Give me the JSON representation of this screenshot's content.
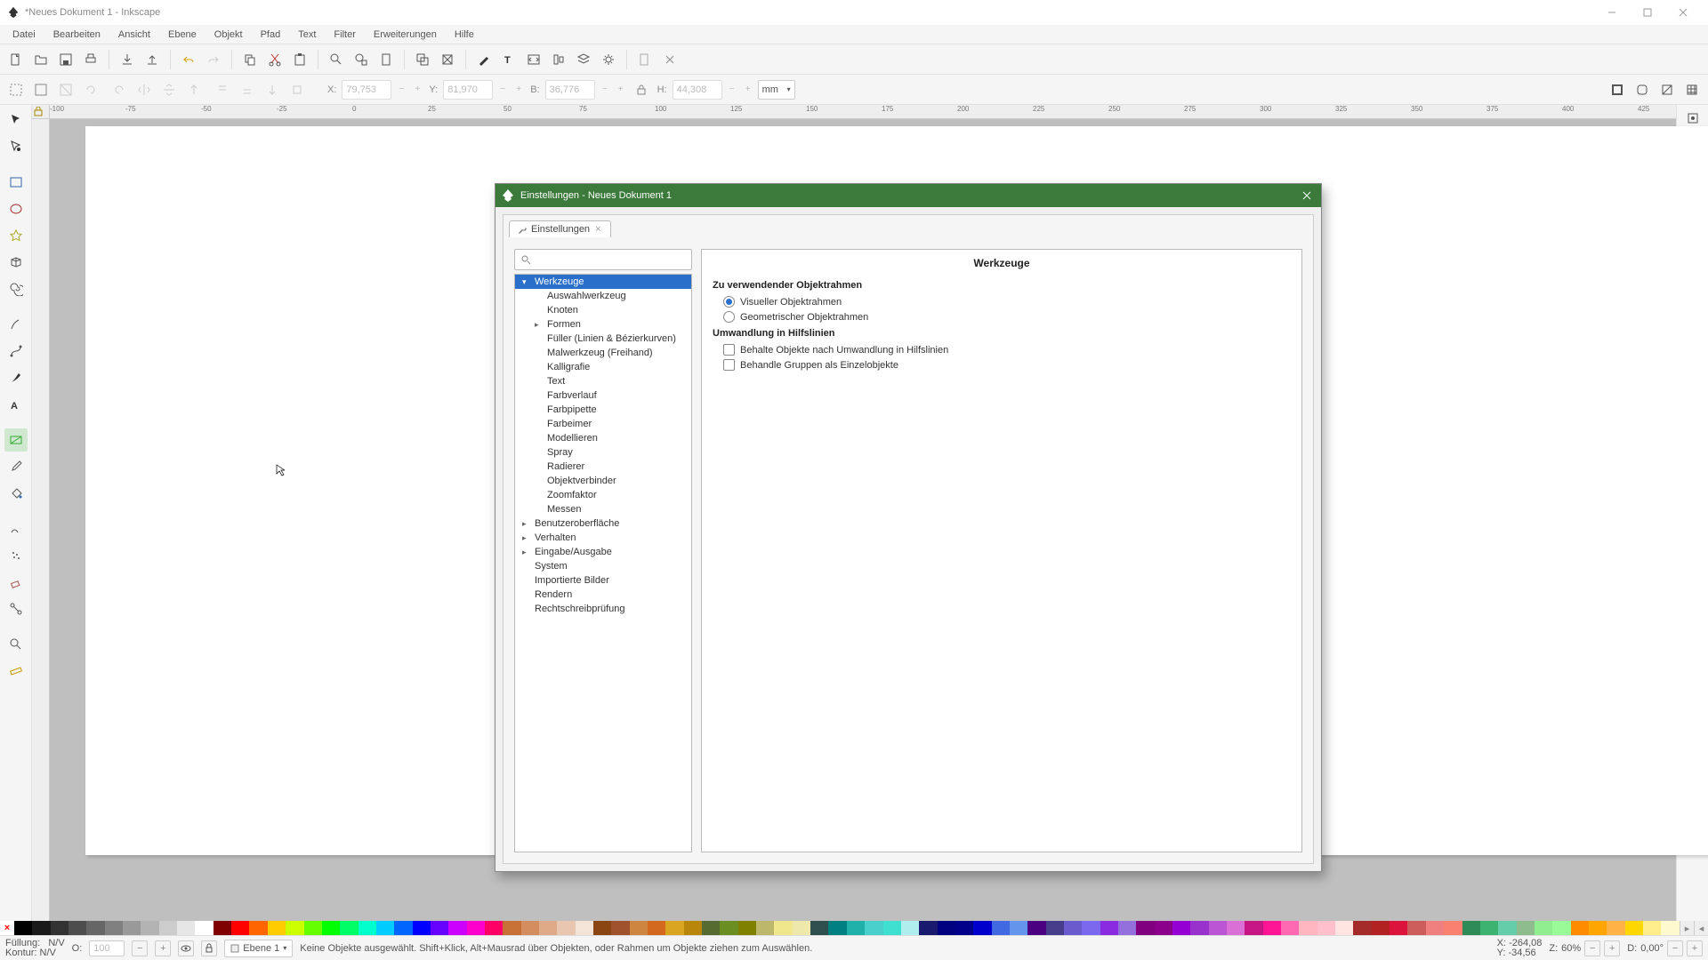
{
  "titlebar": {
    "text": "*Neues Dokument 1 - Inkscape"
  },
  "menu": [
    "Datei",
    "Bearbeiten",
    "Ansicht",
    "Ebene",
    "Objekt",
    "Pfad",
    "Text",
    "Filter",
    "Erweiterungen",
    "Hilfe"
  ],
  "toolbar2": {
    "x_label": "X:",
    "x_value": "79,753",
    "y_label": "Y:",
    "y_value": "81,970",
    "w_label": "B:",
    "w_value": "36,776",
    "h_label": "H:",
    "h_value": "44,308",
    "unit": "mm"
  },
  "ruler_ticks": [
    "-100",
    "-75",
    "-50",
    "-25",
    "0",
    "25",
    "50",
    "75",
    "100",
    "125",
    "150",
    "175",
    "200",
    "225",
    "250",
    "275",
    "300",
    "325",
    "350",
    "375",
    "400",
    "425"
  ],
  "dialog": {
    "title": "Einstellungen - Neues Dokument 1",
    "tab_label": "Einstellungen",
    "tree": {
      "werkzeuge": "Werkzeuge",
      "children": [
        "Auswahlwerkzeug",
        "Knoten",
        "Formen",
        "Füller (Linien & Bézierkurven)",
        "Malwerkzeug (Freihand)",
        "Kalligrafie",
        "Text",
        "Farbverlauf",
        "Farbpipette",
        "Farbeimer",
        "Modellieren",
        "Spray",
        "Radierer",
        "Objektverbinder",
        "Zoomfaktor",
        "Messen"
      ],
      "benutzer": "Benutzeroberfläche",
      "verhalten": "Verhalten",
      "ea": "Eingabe/Ausgabe",
      "system": "System",
      "bilder": "Importierte Bilder",
      "rendern": "Rendern",
      "recht": "Rechtschreibprüfung"
    },
    "panel": {
      "title": "Werkzeuge",
      "sec1": "Zu verwendender Objektrahmen",
      "opt1": "Visueller Objektrahmen",
      "opt2": "Geometrischer Objektrahmen",
      "sec2": "Umwandlung in Hilfslinien",
      "opt3": "Behalte Objekte nach Umwandlung in Hilfslinien",
      "opt4": "Behandle Gruppen als Einzelobjekte"
    }
  },
  "palette": [
    "#000000",
    "#1a1a1a",
    "#333333",
    "#4d4d4d",
    "#666666",
    "#808080",
    "#999999",
    "#b3b3b3",
    "#cccccc",
    "#e6e6e6",
    "#ffffff",
    "#800000",
    "#ff0000",
    "#ff6600",
    "#ffcc00",
    "#ccff00",
    "#66ff00",
    "#00ff00",
    "#00ff66",
    "#00ffcc",
    "#00ccff",
    "#0066ff",
    "#0000ff",
    "#6600ff",
    "#cc00ff",
    "#ff00cc",
    "#ff0066",
    "#c87137",
    "#d38d5f",
    "#deaa87",
    "#e9c6af",
    "#f4e3d7",
    "#8b4513",
    "#a0522d",
    "#cd853f",
    "#d2691e",
    "#daa520",
    "#b8860b",
    "#556b2f",
    "#6b8e23",
    "#808000",
    "#bdb76b",
    "#f0e68c",
    "#eee8aa",
    "#2f4f4f",
    "#008080",
    "#20b2aa",
    "#48d1cc",
    "#40e0d0",
    "#afeeee",
    "#191970",
    "#000080",
    "#00008b",
    "#0000cd",
    "#4169e1",
    "#6495ed",
    "#4b0082",
    "#483d8b",
    "#6a5acd",
    "#7b68ee",
    "#8a2be2",
    "#9370db",
    "#800080",
    "#8b008b",
    "#9400d3",
    "#9932cc",
    "#ba55d3",
    "#da70d6",
    "#c71585",
    "#ff1493",
    "#ff69b4",
    "#ffb6c1",
    "#ffc0cb",
    "#ffe4e1",
    "#a52a2a",
    "#b22222",
    "#dc143c",
    "#cd5c5c",
    "#f08080",
    "#fa8072",
    "#2e8b57",
    "#3cb371",
    "#66cdaa",
    "#8fbc8f",
    "#90ee90",
    "#98fb98",
    "#ff8c00",
    "#ffa500",
    "#ffb347",
    "#ffd700",
    "#ffec8b",
    "#fffacd"
  ],
  "status": {
    "fill_label": "Füllung:",
    "stroke_label": "Kontur:",
    "fill_value": "N/V",
    "stroke_value": "N/V",
    "o_label": "O:",
    "o_value": "100",
    "layer": "Ebene 1",
    "hint": "Keine Objekte ausgewählt. Shift+Klick, Alt+Mausrad über Objekten, oder Rahmen um Objekte ziehen zum Auswählen.",
    "x_label": "X:",
    "x_value": "-264,08",
    "y_label": "Y:",
    "y_value": "-34,56",
    "zoom_label": "Z:",
    "zoom_value": "60%",
    "d_label": "D:",
    "d_value": "0,00°"
  }
}
